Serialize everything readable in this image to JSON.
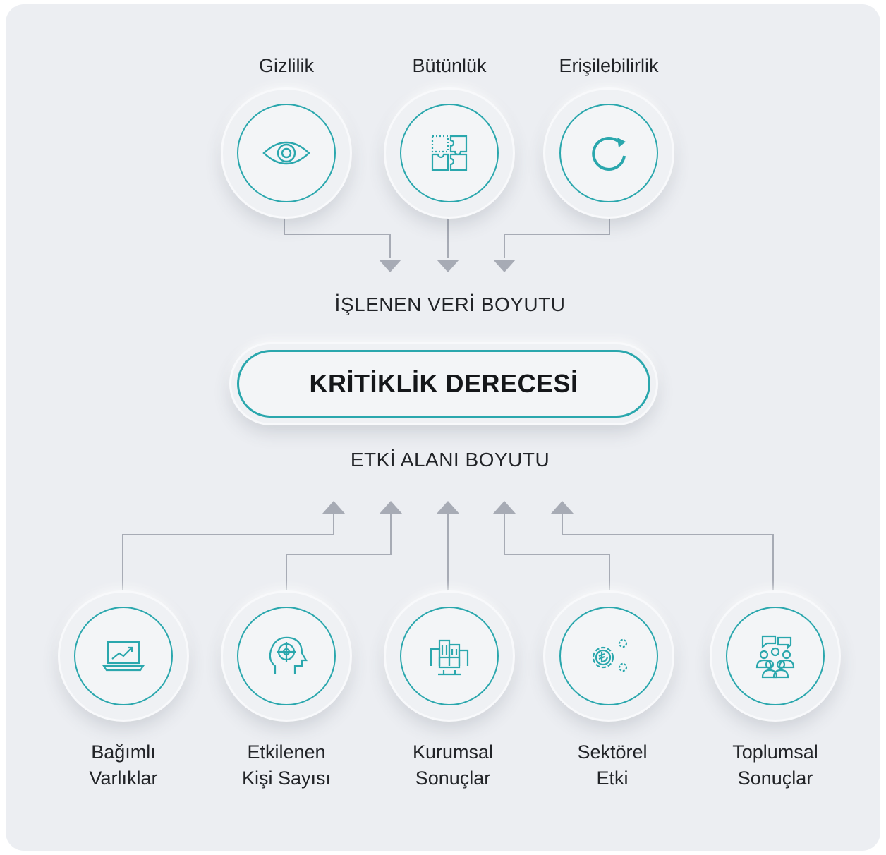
{
  "top_nodes": [
    {
      "label": "Gizlilik",
      "icon": "eye-icon"
    },
    {
      "label": "Bütünlük",
      "icon": "puzzle-icon"
    },
    {
      "label": "Erişilebilirlik",
      "icon": "refresh-icon"
    }
  ],
  "dimension_top": "İŞLENEN VERİ BOYUTU",
  "center_title": "KRİTİKLİK DERECESİ",
  "dimension_bottom": "ETKİ ALANI BOYUTU",
  "bottom_nodes": [
    {
      "line1": "Bağımlı",
      "line2": "Varlıklar",
      "icon": "laptop-chart-icon"
    },
    {
      "line1": "Etkilenen",
      "line2": "Kişi Sayısı",
      "icon": "head-target-icon"
    },
    {
      "line1": "Kurumsal",
      "line2": "Sonuçlar",
      "icon": "buildings-icon"
    },
    {
      "line1": "Sektörel",
      "line2": "Etki",
      "icon": "gear-lira-icon"
    },
    {
      "line1": "Toplumsal",
      "line2": "Sonuçlar",
      "icon": "people-chat-icon"
    }
  ],
  "colors": {
    "accent": "#2aa7ad",
    "connector": "#a7abb5",
    "background": "#eceef2",
    "text": "#222428"
  }
}
